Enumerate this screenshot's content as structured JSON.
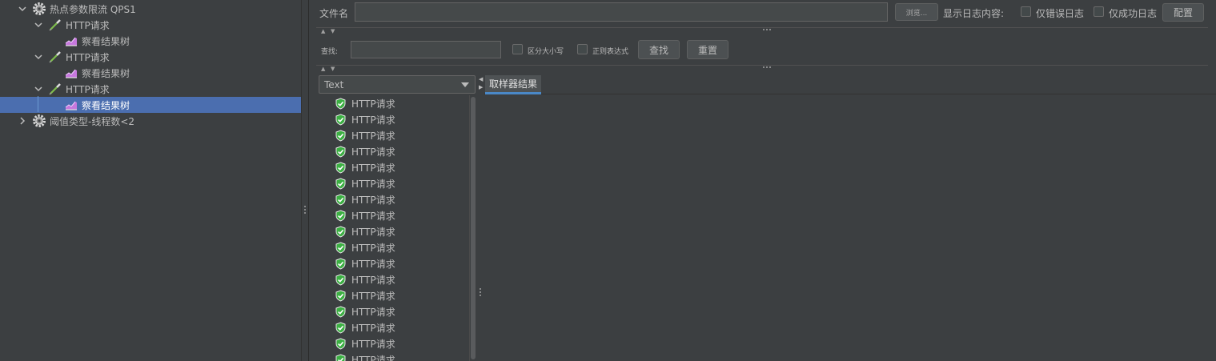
{
  "tree": {
    "items": [
      {
        "label": "热点参数限流 QPS1",
        "icon": "gear-icon",
        "expanded": true
      },
      {
        "label": "HTTP请求",
        "icon": "pipette-icon",
        "expanded": true
      },
      {
        "label": "察看结果树",
        "icon": "chart-icon"
      },
      {
        "label": "HTTP请求",
        "icon": "pipette-icon",
        "expanded": true
      },
      {
        "label": "察看结果树",
        "icon": "chart-icon"
      },
      {
        "label": "HTTP请求",
        "icon": "pipette-icon",
        "expanded": true
      },
      {
        "label": "察看结果树",
        "icon": "chart-icon",
        "selected": true
      },
      {
        "label": "阈值类型-线程数<2",
        "icon": "gear-icon",
        "expanded": false
      }
    ]
  },
  "file": {
    "label": "文件名",
    "value": "",
    "browse_label": "浏览...",
    "log_label": "显示日志内容:",
    "errors_only_label": "仅错误日志",
    "success_only_label": "仅成功日志",
    "configure_label": "配置"
  },
  "search": {
    "label": "查找:",
    "value": "",
    "case_sensitive_label": "区分大小写",
    "regex_label": "正则表达式",
    "find_label": "查找",
    "reset_label": "重置"
  },
  "renderer": {
    "selected": "Text"
  },
  "results": [
    "HTTP请求",
    "HTTP请求",
    "HTTP请求",
    "HTTP请求",
    "HTTP请求",
    "HTTP请求",
    "HTTP请求",
    "HTTP请求",
    "HTTP请求",
    "HTTP请求",
    "HTTP请求",
    "HTTP请求",
    "HTTP请求",
    "HTTP请求",
    "HTTP请求",
    "HTTP请求",
    "HTTP请求"
  ],
  "tabs": [
    {
      "label": "取样器结果",
      "active": true
    }
  ],
  "colors": {
    "background": "#3c3f41",
    "selection": "#4b6eaf",
    "success": "#3cb043",
    "tab_accent": "#4a88c7"
  }
}
